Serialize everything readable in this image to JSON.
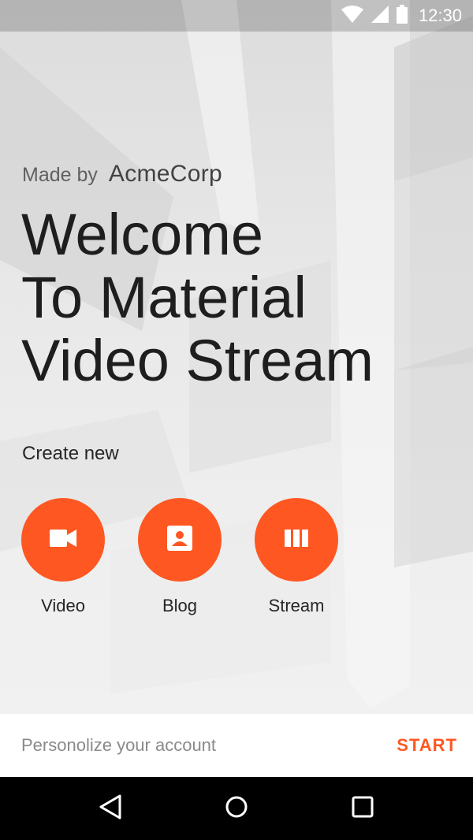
{
  "status_bar": {
    "time": "12:30",
    "icons": [
      "wifi-icon",
      "cellular-signal-icon",
      "battery-icon"
    ]
  },
  "header": {
    "made_by_label": "Made by",
    "brand": "AcmeCorp"
  },
  "title_lines": [
    "Welcome",
    "To Material",
    "Video Stream"
  ],
  "create_section": {
    "heading": "Create new",
    "actions": [
      {
        "label": "Video",
        "icon": "videocam-icon"
      },
      {
        "label": "Blog",
        "icon": "contact-card-icon"
      },
      {
        "label": "Stream",
        "icon": "view-columns-icon"
      }
    ]
  },
  "bottom_bar": {
    "prompt": "Personolize your account",
    "action": "START"
  },
  "nav_bar": {
    "buttons": [
      "back-icon",
      "home-icon",
      "recents-icon"
    ]
  },
  "colors": {
    "accent": "#ff5722",
    "title_text": "#1e1e1e",
    "nav_background": "#000000"
  }
}
